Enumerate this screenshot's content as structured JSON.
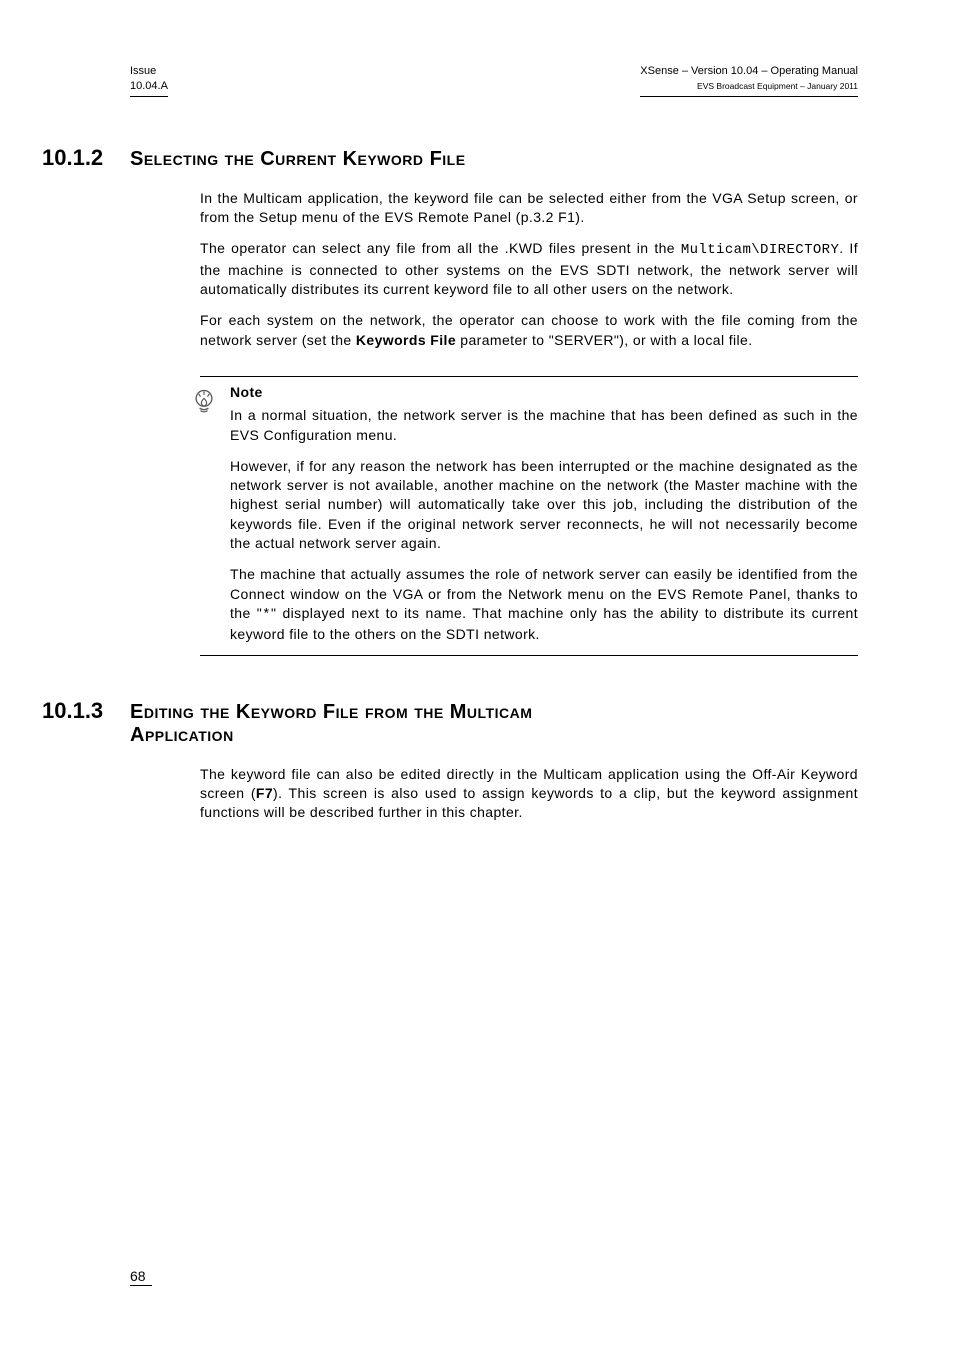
{
  "header": {
    "left_line1": "Issue",
    "left_line2": "10.04.A",
    "right_line1": "XSense – Version 10.04 – Operating Manual",
    "right_line2": "EVS Broadcast Equipment  – January 2011"
  },
  "section1": {
    "num": "10.1.2",
    "title": "Selecting the Current Keyword File",
    "p1": "In the Multicam application, the keyword file can be selected either from the VGA Setup screen, or from the Setup menu of the EVS Remote Panel (p.3.2 F1).",
    "p2_pre": "The operator can select any file from all the .KWD files present in the ",
    "p2_code": "Multicam\\DIRECTORY",
    "p2_post": ". If the machine is connected to other systems on the EVS SDTI network, the network server will automatically distributes its current keyword file to all other users on the network.",
    "p3_a": "For each system on the network, the operator can choose to work with the file coming from the network server (set the ",
    "p3_b": "Keywords File",
    "p3_c": " parameter to \"SERVER\"), or with a local file."
  },
  "note": {
    "label": "Note",
    "p1": "In a normal situation, the network server is the machine that has been defined as such in the EVS Configuration menu.",
    "p2": "However, if for any reason the network has been interrupted or the machine designated as the network server is not available, another machine on the network (the Master machine with the highest serial number) will automatically take over this job, including the distribution of the keywords file. Even if the original network server reconnects, he will not necessarily become the actual network server again.",
    "p3_a": "The machine that actually assumes the role of network server can easily be identified from the Connect window on the VGA or from the Network menu on the EVS Remote Panel, thanks to the \"",
    "p3_b": "*",
    "p3_c": "\" displayed next to its name. That machine only has the ability to distribute its current keyword file to the others on the SDTI network."
  },
  "section2": {
    "num": "10.1.3",
    "title_l1": "Editing the Keyword File from the Multicam",
    "title_l2": "Application",
    "p1_a": "The keyword file can also be edited directly in the Multicam application using the Off-Air Keyword screen (",
    "p1_b": "F7",
    "p1_c": "). This screen is also used to assign keywords to a clip, but the keyword assignment functions will be described further in this chapter."
  },
  "footer": {
    "page": "68"
  },
  "icons": {
    "note_icon": "note-bulb-icon"
  }
}
